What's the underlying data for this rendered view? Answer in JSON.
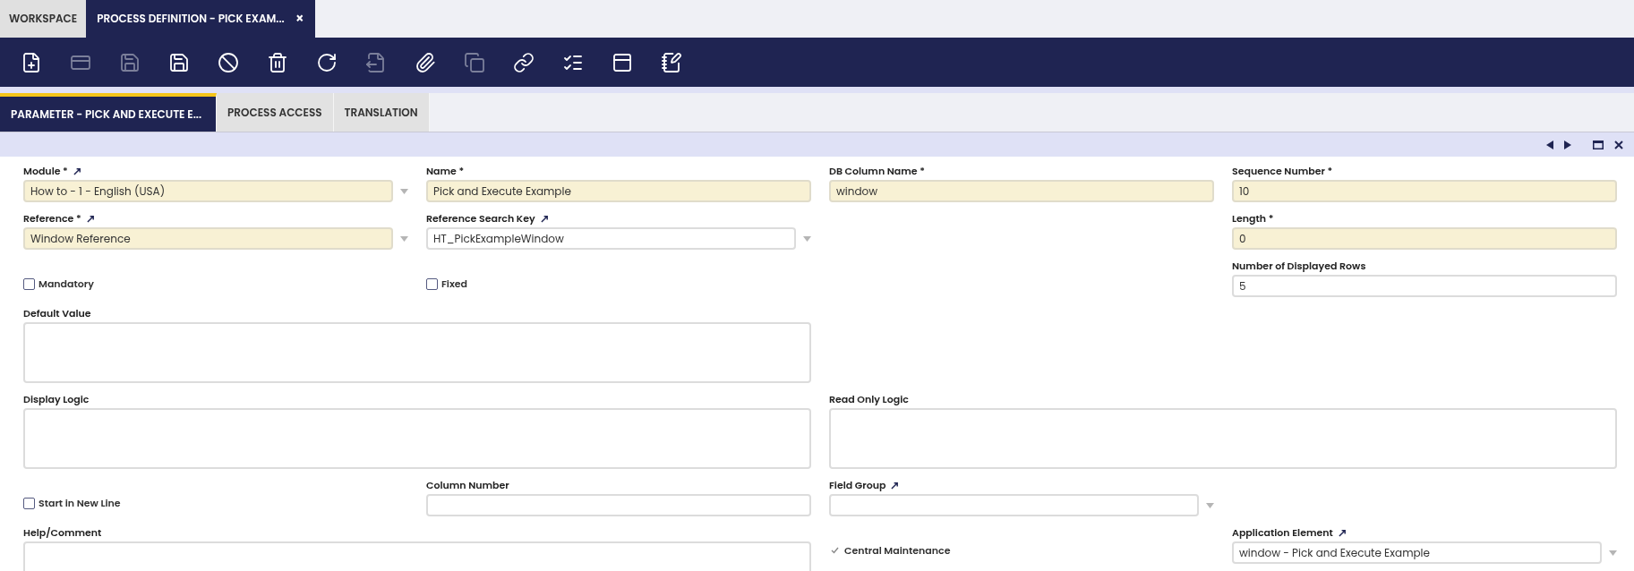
{
  "window_tabs": [
    {
      "label": "WORKSPACE",
      "selected": false,
      "closable": false
    },
    {
      "label": "PROCESS DEFINITION - PICK EXAM...",
      "selected": true,
      "closable": true
    }
  ],
  "close_glyph": "×",
  "toolbar": [
    {
      "disabled": false
    },
    {
      "disabled": true
    },
    {
      "disabled": true
    },
    {
      "disabled": false
    },
    {
      "disabled": false
    },
    {
      "disabled": false
    },
    {
      "disabled": false
    },
    {
      "disabled": true
    },
    {
      "disabled": false
    },
    {
      "disabled": true
    },
    {
      "disabled": false
    },
    {
      "disabled": false
    },
    {
      "disabled": false
    },
    {
      "disabled": false
    }
  ],
  "sub_tabs": [
    {
      "label": "PARAMETER - PICK AND EXECUTE E...",
      "selected": true
    },
    {
      "label": "PROCESS ACCESS",
      "selected": false
    },
    {
      "label": "TRANSLATION",
      "selected": false
    }
  ],
  "fields": [
    {
      "kind": "select",
      "label": "Module *",
      "link": true,
      "required": true,
      "value": "How to - 1 - English (USA)"
    },
    {
      "kind": "text",
      "label": "Name *",
      "required": true,
      "value": "Pick and Execute Example"
    },
    {
      "kind": "text",
      "label": "DB Column Name *",
      "required": true,
      "value": "window"
    },
    {
      "kind": "text",
      "label": "Sequence Number *",
      "required": true,
      "value": "10"
    },
    {
      "kind": "select",
      "label": "Reference *",
      "link": true,
      "required": true,
      "value": "Window Reference"
    },
    {
      "kind": "select",
      "label": "Reference Search Key",
      "link": true,
      "required": false,
      "value": "HT_PickExampleWindow"
    },
    {
      "kind": "text",
      "label": "Length *",
      "required": true,
      "value": "0"
    },
    {
      "kind": "checkbox",
      "label": "Mandatory",
      "checked": false,
      "disabled": false
    },
    {
      "kind": "checkbox",
      "label": "Fixed",
      "checked": false,
      "disabled": false
    },
    {
      "kind": "text",
      "label": "Number of Displayed Rows",
      "required": false,
      "value": "5"
    },
    {
      "kind": "textarea",
      "label": "Default Value"
    },
    {
      "kind": "textarea",
      "label": "Display Logic"
    },
    {
      "kind": "textarea",
      "label": "Read Only Logic"
    },
    {
      "kind": "checkbox",
      "label": "Start in New Line",
      "checked": false,
      "disabled": false
    },
    {
      "kind": "text",
      "label": "Column Number",
      "required": false
    },
    {
      "kind": "select",
      "label": "Field Group",
      "link": true,
      "required": false
    },
    {
      "kind": "textarea",
      "label": "Help/Comment"
    },
    {
      "kind": "checkbox",
      "label": "Central Maintenance",
      "checked": true,
      "disabled": true
    },
    {
      "kind": "select",
      "label": "Application Element",
      "link": true,
      "required": false,
      "value": "window - Pick and Execute Example"
    }
  ]
}
